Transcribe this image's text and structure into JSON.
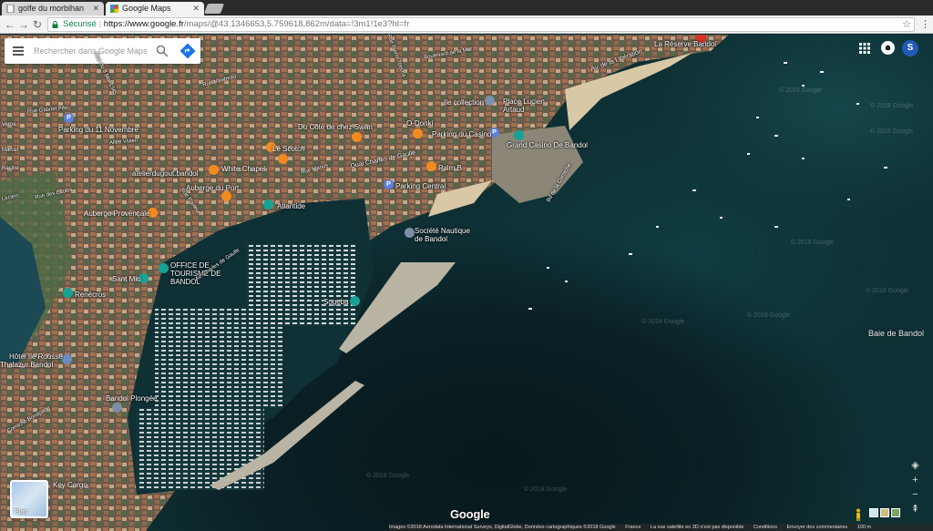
{
  "browser": {
    "tabs": [
      {
        "title": "golfe du morbihan",
        "active": false
      },
      {
        "title": "Google Maps",
        "active": true
      }
    ],
    "secure_label": "Sécurisé",
    "url_host": "https://www.google.fr",
    "url_path": "/maps/@43.1346653,5.759618,862m/data=!3m1!1e3?hl=fr"
  },
  "search": {
    "placeholder": "Rechercher dans Google Maps"
  },
  "account": {
    "avatar_letter": "S"
  },
  "places": [
    {
      "name": "La Réserve Bandol",
      "type": "red"
    },
    {
      "name": "Ile collection",
      "type": "poi"
    },
    {
      "name": "Place Lucien Artaud",
      "type": "label"
    },
    {
      "name": "Du Côté de chez Swan",
      "type": "food"
    },
    {
      "name": "O-Donki",
      "type": "food"
    },
    {
      "name": "Parking du Casino",
      "type": "park"
    },
    {
      "name": "Grand Casino De Bandol",
      "type": "tour"
    },
    {
      "name": "Parking du 11 Novembre",
      "type": "park"
    },
    {
      "name": "Le Scotch",
      "type": "food"
    },
    {
      "name": "White Chapel",
      "type": "food"
    },
    {
      "name": "Quai Charles de Gaulle",
      "type": "label"
    },
    {
      "name": "Palm.B",
      "type": "food"
    },
    {
      "name": "atelierdugout.bandol",
      "type": "food"
    },
    {
      "name": "Auberge du Port",
      "type": "food"
    },
    {
      "name": "Parking Central",
      "type": "park"
    },
    {
      "name": "Atlantide",
      "type": "tour"
    },
    {
      "name": "Auberge Provençale",
      "type": "food"
    },
    {
      "name": "Société Nautique de Bandol",
      "type": "poi"
    },
    {
      "name": "OFFICE DE TOURISME DE BANDOL",
      "type": "tour"
    },
    {
      "name": "Sant Mio",
      "type": "tour"
    },
    {
      "name": "Renécros",
      "type": "tour"
    },
    {
      "name": "Sogeba",
      "type": "tour"
    },
    {
      "name": "Hôtel Ile Rousse",
      "type": "gray"
    },
    {
      "name": "Thalazur Bandol",
      "type": "label"
    },
    {
      "name": "Bandol Plongée",
      "type": "poi"
    },
    {
      "name": "Key Cargo",
      "type": "label"
    }
  ],
  "streets": [
    "Rue du 8 Mai 1945",
    "Rue Mirabeau",
    "Boulevard de la Mer",
    "Rue Pierre Toesca",
    "Av. de la Libération",
    "Rue Marius",
    "Bd de la Corniche",
    "Rue Pasteur",
    "Rue des Écoles",
    "Allée Vivien",
    "Rue Gabriel Péri",
    "Av. Charles de Gaulle",
    "Corniche Bonaparte",
    "Leclerc",
    "Racine",
    "Verne",
    "Marcel"
  ],
  "bay_label": "Baie de Bandol",
  "watermark": "© 2018 Google",
  "map_type_button": "Plan",
  "logo": "Google",
  "footer": [
    "Images ©2018 Aerodata International Surveys, DigitalGlobe, Données cartographiques ©2018 Google",
    "France",
    "La vue satellite en 3D n'est pas disponible",
    "Conditions",
    "Envoyer des commentaires",
    "100 m"
  ],
  "icons": {
    "menu": "hamburger-icon",
    "search": "search-icon",
    "directions": "directions-icon",
    "apps": "apps-grid-icon",
    "notifications": "notifications-icon",
    "compass": "compass-icon",
    "zoom_in": "plus-icon",
    "zoom_out": "minus-icon",
    "tilt": "tilt-icon",
    "pegman": "pegman-icon"
  }
}
